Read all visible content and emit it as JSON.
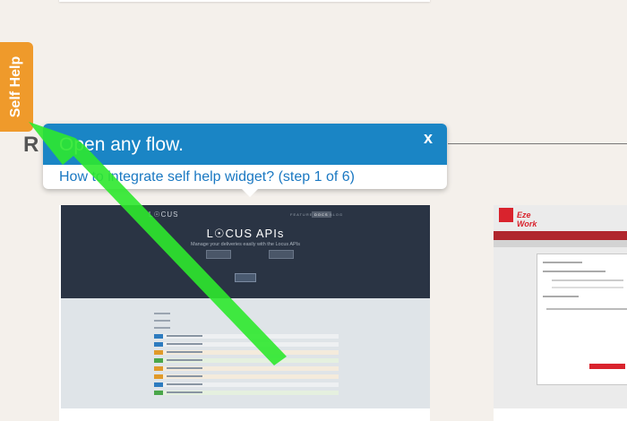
{
  "self_help": {
    "label": "Self Help"
  },
  "section": {
    "heading_partial": "R"
  },
  "tooltip": {
    "title": "Open any flow.",
    "close_label": "x",
    "link_text": "How to integrate self help widget? (step 1 of 6)"
  },
  "card_locus": {
    "logo": "L☉CUS",
    "nav": [
      "FEATURES",
      "DOCS",
      "BLOG"
    ],
    "title": "L☉CUS APIs",
    "subtitle": "Manage your deliveries easily with the Locus APIs"
  },
  "card_eze": {
    "logo": "Eze Work"
  },
  "colors": {
    "background": "#f4f0eb",
    "self_help_tab": "#ef9a2b",
    "tooltip_header": "#1a85c5",
    "link": "#1a78c2",
    "arrow": "#2ee82e"
  }
}
